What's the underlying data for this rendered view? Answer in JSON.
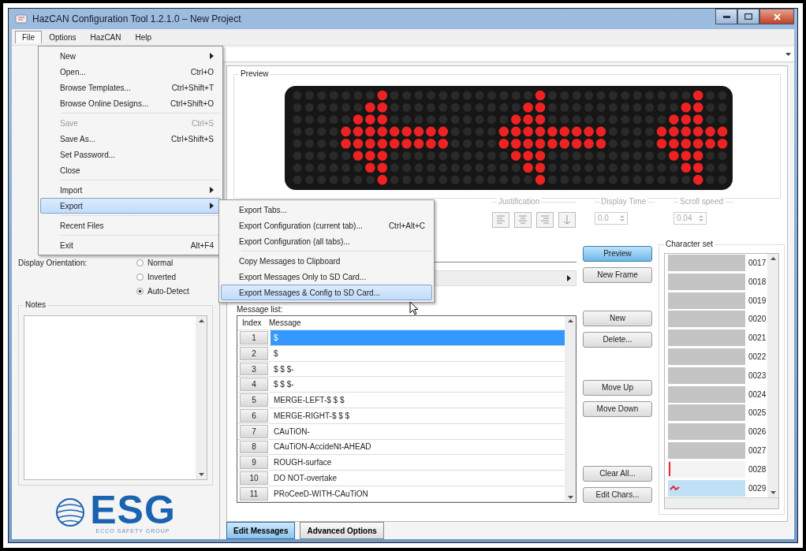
{
  "window": {
    "title": "HazCAN Configuration Tool 1.2.1.0 – New Project"
  },
  "menu_bar": [
    {
      "label": "File",
      "selected": true
    },
    {
      "label": "Options",
      "selected": false
    },
    {
      "label": "HazCAN",
      "selected": false
    },
    {
      "label": "Help",
      "selected": false
    }
  ],
  "file_menu": [
    {
      "kind": "item",
      "label": "New",
      "submenu": true,
      "disabled": false,
      "selected": false
    },
    {
      "kind": "item",
      "label": "Open...",
      "shortcut": "Ctrl+O",
      "submenu": false,
      "disabled": false,
      "selected": false
    },
    {
      "kind": "item",
      "label": "Browse Templates...",
      "shortcut": "Ctrl+Shift+T",
      "submenu": false,
      "disabled": false,
      "selected": false
    },
    {
      "kind": "item",
      "label": "Browse Online Designs...",
      "shortcut": "Ctrl+Shift+O",
      "submenu": false,
      "disabled": false,
      "selected": false
    },
    {
      "kind": "separator"
    },
    {
      "kind": "item",
      "label": "Save",
      "shortcut": "Ctrl+S",
      "submenu": false,
      "disabled": true,
      "selected": false
    },
    {
      "kind": "item",
      "label": "Save As...",
      "shortcut": "Ctrl+Shift+S",
      "submenu": false,
      "disabled": false,
      "selected": false
    },
    {
      "kind": "item",
      "label": "Set Password...",
      "submenu": false,
      "disabled": false,
      "selected": false
    },
    {
      "kind": "item",
      "label": "Close",
      "submenu": false,
      "disabled": false,
      "selected": false
    },
    {
      "kind": "separator"
    },
    {
      "kind": "item",
      "label": "Import",
      "submenu": true,
      "disabled": false,
      "selected": false
    },
    {
      "kind": "item",
      "label": "Export",
      "submenu": true,
      "disabled": false,
      "selected": true
    },
    {
      "kind": "separator"
    },
    {
      "kind": "item",
      "label": "Recent Files",
      "submenu": false,
      "disabled": false,
      "selected": false
    },
    {
      "kind": "separator"
    },
    {
      "kind": "item",
      "label": "Exit",
      "shortcut": "Alt+F4",
      "submenu": false,
      "disabled": false,
      "selected": false
    }
  ],
  "export_submenu": [
    {
      "kind": "item",
      "label": "Export Tabs...",
      "selected": false
    },
    {
      "kind": "item",
      "label": "Export Configuration (current tab)...",
      "shortcut": "Ctrl+Alt+C",
      "selected": false
    },
    {
      "kind": "item",
      "label": "Export Configuration (all tabs)...",
      "selected": false
    },
    {
      "kind": "separator"
    },
    {
      "kind": "item",
      "label": "Copy Messages to Clipboard",
      "selected": false
    },
    {
      "kind": "item",
      "label": "Export Messages Only to SD Card...",
      "selected": false
    },
    {
      "kind": "item",
      "label": "Export Messages & Config to SD Card...",
      "selected": true
    }
  ],
  "display_orientation": {
    "label": "Display Orientation:",
    "options": [
      {
        "label": "Normal",
        "selected": false
      },
      {
        "label": "Inverted",
        "selected": false
      },
      {
        "label": "Auto-Detect",
        "selected": true
      }
    ]
  },
  "notes": {
    "title": "Notes"
  },
  "logo": {
    "wordmark": "ESG",
    "tagline": "ECCO SAFETY GROUP"
  },
  "preview": {
    "title": "Preview"
  },
  "justification": {
    "title": "Justification",
    "disabled": true
  },
  "display_time": {
    "title": "Display Time",
    "value": "0.0",
    "disabled": true
  },
  "scroll_speed": {
    "title": "Scroll speed",
    "value": "0.04",
    "disabled": true
  },
  "frame_buttons": [
    {
      "label": "Preview",
      "default": true
    },
    {
      "label": "New Frame",
      "default": false
    }
  ],
  "message_list": {
    "title": "Message list:",
    "columns": [
      "Index",
      "Message"
    ],
    "rows": [
      {
        "index": "1",
        "message": "$",
        "selected": true
      },
      {
        "index": "2",
        "message": "$",
        "selected": false
      },
      {
        "index": "3",
        "message": "$ $ $-",
        "selected": false
      },
      {
        "index": "4",
        "message": "$ $ $-",
        "selected": false
      },
      {
        "index": "5",
        "message": "MERGE-LEFT-$ $ $",
        "selected": false
      },
      {
        "index": "6",
        "message": "MERGE-RIGHT-$ $ $",
        "selected": false
      },
      {
        "index": "7",
        "message": "CAuTiON-",
        "selected": false
      },
      {
        "index": "8",
        "message": "CAuTiON-AccideNt-AHEAD",
        "selected": false
      },
      {
        "index": "9",
        "message": "ROUGH-surface",
        "selected": false
      },
      {
        "index": "10",
        "message": "DO NOT-overtake",
        "selected": false
      },
      {
        "index": "11",
        "message": "PRoCeeD-WITH-CAuTiON",
        "selected": false
      }
    ]
  },
  "list_buttons": [
    [
      "New",
      "Delete..."
    ],
    [
      "Move Up",
      "Move Down"
    ],
    [
      "Clear All...",
      "Edit Chars..."
    ]
  ],
  "character_set": {
    "title": "Character set",
    "items": [
      {
        "code": "0017",
        "kind": "blank",
        "selected": false
      },
      {
        "code": "0018",
        "kind": "blank",
        "selected": false
      },
      {
        "code": "0019",
        "kind": "blank",
        "selected": false
      },
      {
        "code": "0020",
        "kind": "blank",
        "selected": false
      },
      {
        "code": "0021",
        "kind": "blank",
        "selected": false
      },
      {
        "code": "0022",
        "kind": "blank",
        "selected": false
      },
      {
        "code": "0023",
        "kind": "blank",
        "selected": false
      },
      {
        "code": "0024",
        "kind": "blank",
        "selected": false
      },
      {
        "code": "0025",
        "kind": "blank",
        "selected": false
      },
      {
        "code": "0026",
        "kind": "blank",
        "selected": false
      },
      {
        "code": "0027",
        "kind": "blank",
        "selected": false
      },
      {
        "code": "0028",
        "kind": "glyph",
        "selected": false
      },
      {
        "code": "0029",
        "kind": "glyph",
        "selected": true
      }
    ]
  },
  "tabs": [
    {
      "label": "Edit Messages",
      "selected": true
    },
    {
      "label": "Advanced Options",
      "selected": false
    }
  ]
}
